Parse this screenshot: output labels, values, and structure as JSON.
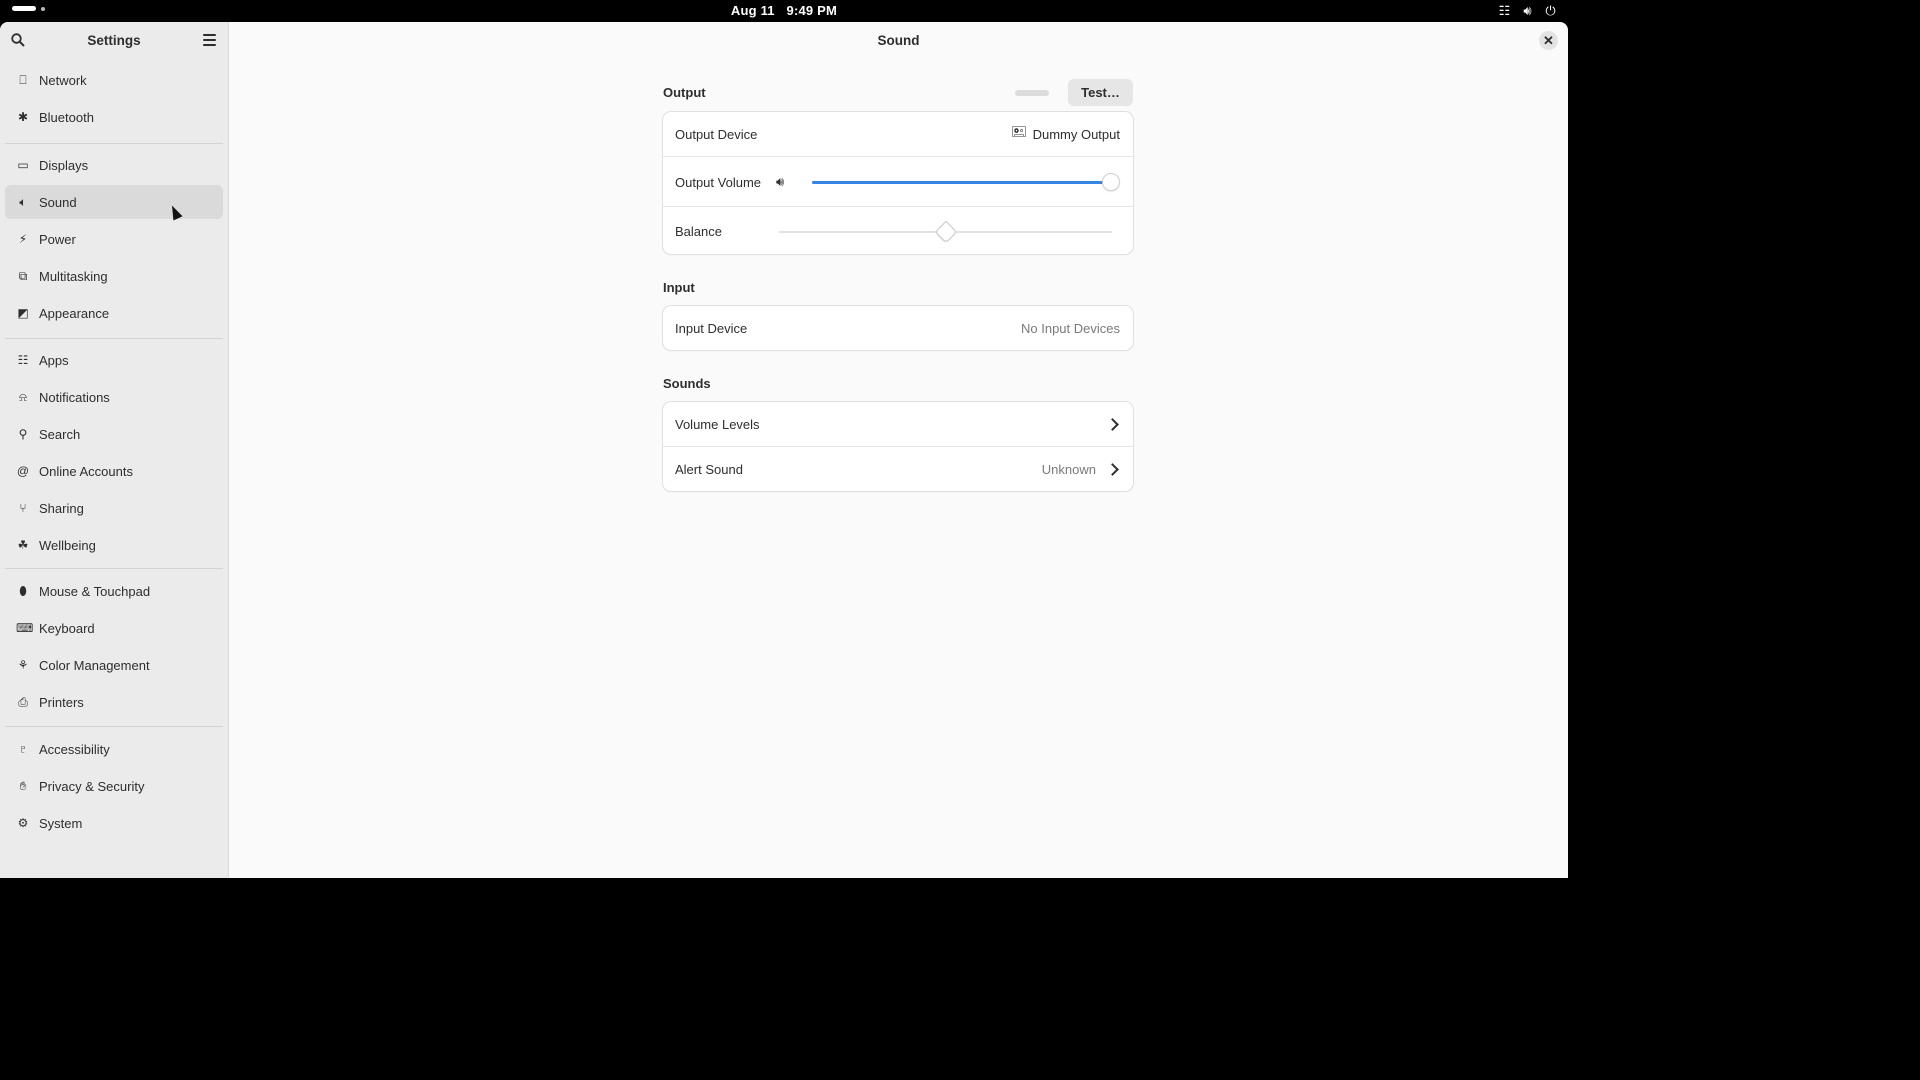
{
  "topbar": {
    "date": "Aug 11",
    "time": "9:49 PM",
    "tray_icons": [
      "network-icon",
      "volume-icon",
      "power-icon"
    ]
  },
  "sidebar": {
    "title": "Settings",
    "items": [
      {
        "label": "Network",
        "icon": "network-icon"
      },
      {
        "label": "Bluetooth",
        "icon": "bluetooth-icon"
      },
      {
        "label": "Displays",
        "icon": "display-icon"
      },
      {
        "label": "Sound",
        "icon": "speaker-icon",
        "active": true
      },
      {
        "label": "Power",
        "icon": "battery-icon"
      },
      {
        "label": "Multitasking",
        "icon": "multitasking-icon"
      },
      {
        "label": "Appearance",
        "icon": "appearance-icon"
      },
      {
        "label": "Apps",
        "icon": "apps-grid-icon"
      },
      {
        "label": "Notifications",
        "icon": "bell-icon"
      },
      {
        "label": "Search",
        "icon": "search-icon"
      },
      {
        "label": "Online Accounts",
        "icon": "at-icon"
      },
      {
        "label": "Sharing",
        "icon": "share-icon"
      },
      {
        "label": "Wellbeing",
        "icon": "wellbeing-icon"
      },
      {
        "label": "Mouse & Touchpad",
        "icon": "mouse-icon"
      },
      {
        "label": "Keyboard",
        "icon": "keyboard-icon"
      },
      {
        "label": "Color Management",
        "icon": "color-icon"
      },
      {
        "label": "Printers",
        "icon": "printer-icon"
      },
      {
        "label": "Accessibility",
        "icon": "accessibility-icon"
      },
      {
        "label": "Privacy & Security",
        "icon": "hand-icon"
      },
      {
        "label": "System",
        "icon": "gear-icon"
      }
    ]
  },
  "main": {
    "title": "Sound",
    "output": {
      "section_title": "Output",
      "test_label": "Test…",
      "device_label": "Output Device",
      "device_value": "Dummy Output",
      "volume_label": "Output Volume",
      "volume_level": 1.0,
      "balance_label": "Balance",
      "balance_level": 0.5
    },
    "input": {
      "section_title": "Input",
      "device_label": "Input Device",
      "device_value": "No Input Devices"
    },
    "sounds": {
      "section_title": "Sounds",
      "volume_levels_label": "Volume Levels",
      "alert_label": "Alert Sound",
      "alert_value": "Unknown"
    }
  },
  "colors": {
    "accent": "#3584e4",
    "sidebar_bg": "#ebebeb",
    "content_bg": "#fafafa"
  }
}
